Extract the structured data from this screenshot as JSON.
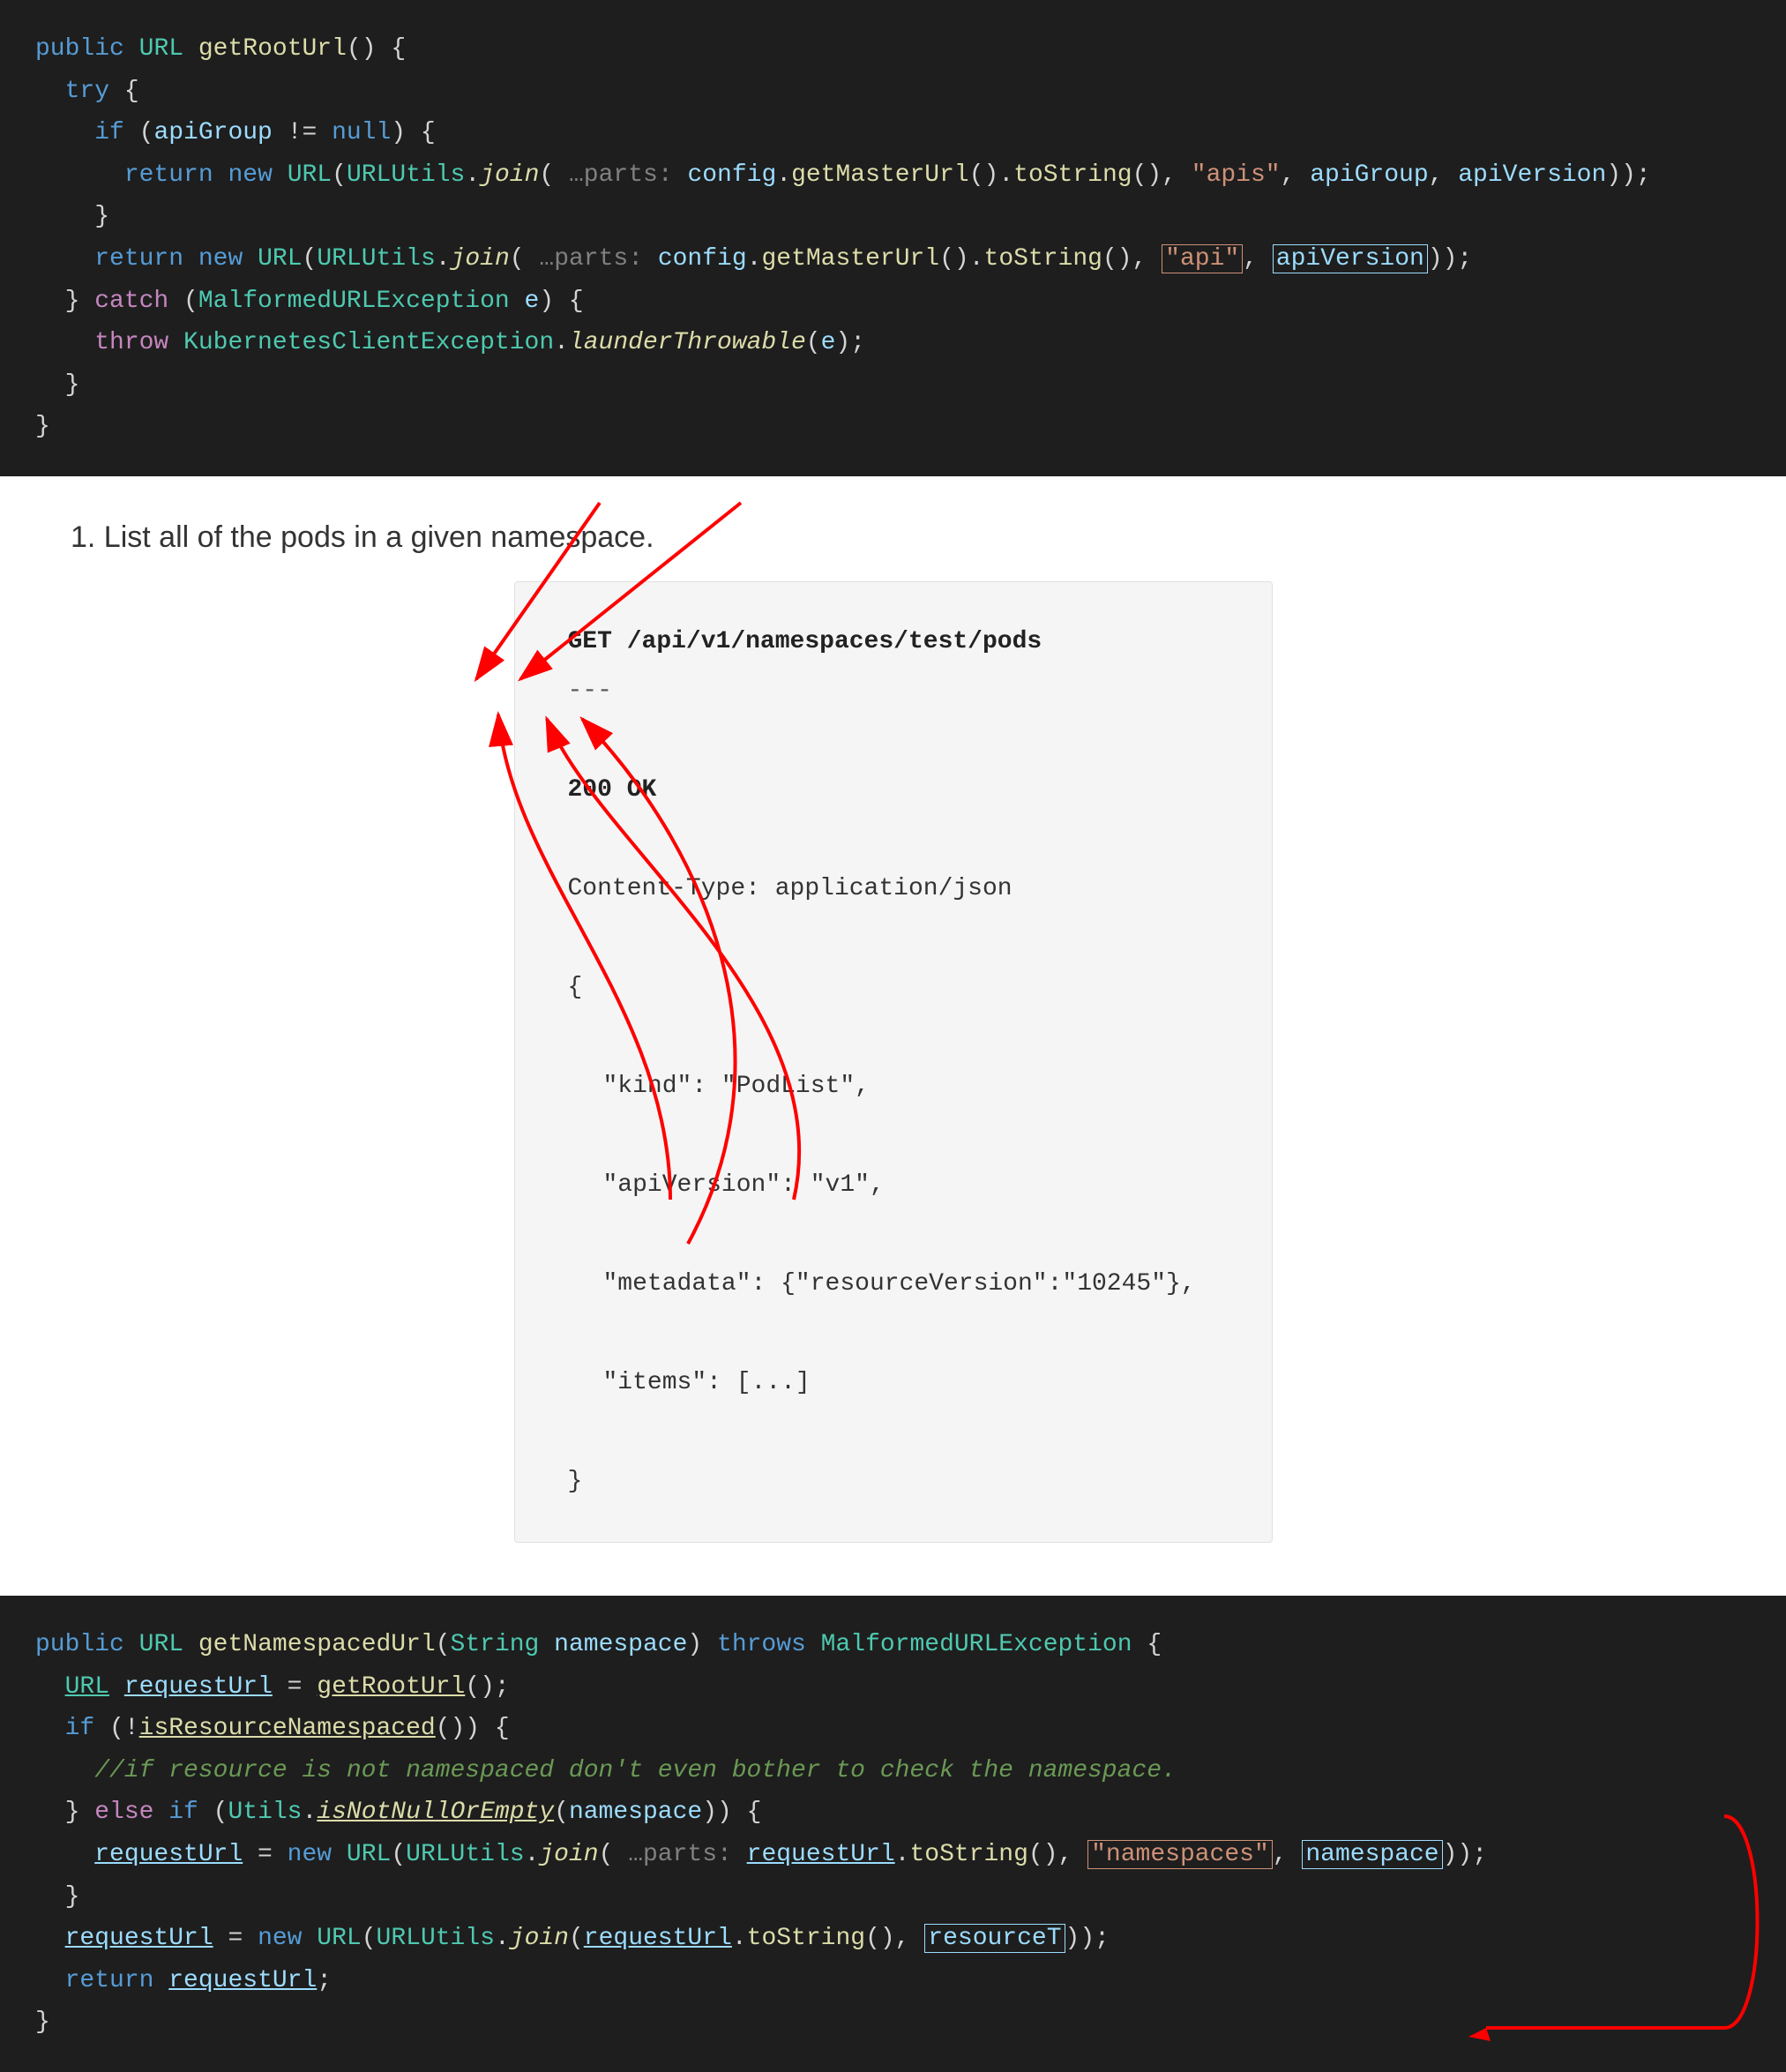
{
  "topCode": {
    "lines": [
      {
        "text": "public URL getRootUrl() {"
      },
      {
        "text": "  try {"
      },
      {
        "text": "    if (apiGroup != null) {"
      },
      {
        "text": "      return new URL(URLUtils.join( …parts: config.getMasterUrl().toString(), \"apis\", apiGroup, apiVersion));"
      },
      {
        "text": "    }"
      },
      {
        "text": "    return new URL(URLUtils.join( …parts: config.getMasterUrl().toString(), \"api\", apiVersion));"
      },
      {
        "text": "  } catch (MalformedURLException e) {"
      },
      {
        "text": "    throw KubernetesClientException.launderThrowable(e);"
      },
      {
        "text": "  }"
      },
      {
        "text": "}"
      }
    ]
  },
  "listItem": "1. List all of the pods in a given namespace.",
  "apiBox": {
    "line1": "GET /api/v1/namespaces/test/pods",
    "sep": "---",
    "status": "200 OK",
    "contentType": "Content-Type: application/json",
    "json": [
      "{",
      "    \"kind\": \"PodList\",",
      "    \"apiVersion\": \"v1\",",
      "    \"metadata\": {\"resourceVersion\":\"10245\"},",
      "    \"items\": [...]",
      "}"
    ]
  },
  "bottomCode": {
    "line1": "public URL getNamespacedUrl(String namespace) throws MalformedURLException {",
    "line2": "  URL requestUrl = getRootUrl();",
    "line3": "  if (!isResourceNamespaced()) {",
    "line4": "    //if resource is not namespaced don't even bother to check the namespace.",
    "line5": "  } else if (Utils.isNotNullOrEmpty(namespace)) {",
    "line6": "    requestUrl = new URL(URLUtils.join( …parts: requestUrl.toString(), \"namespaces\", namespace));",
    "line7": "  }",
    "line8": "  requestUrl = new URL(URLUtils.join(requestUrl.toString(), resourceT));",
    "line9": "  return requestUrl;",
    "line10": "}"
  }
}
